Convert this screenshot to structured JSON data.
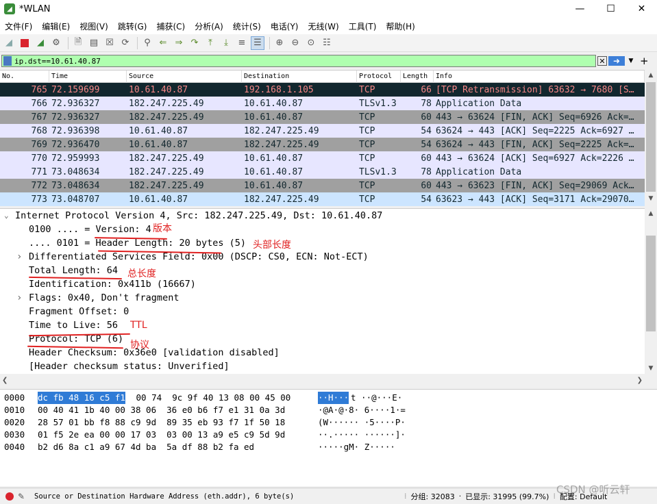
{
  "window": {
    "title": "*WLAN"
  },
  "menu": [
    "文件(F)",
    "编辑(E)",
    "视图(V)",
    "跳转(G)",
    "捕获(C)",
    "分析(A)",
    "统计(S)",
    "电话(Y)",
    "无线(W)",
    "工具(T)",
    "帮助(H)"
  ],
  "filter": {
    "value": "ip.dst==10.61.40.87"
  },
  "columns": [
    "No.",
    "Time",
    "Source",
    "Destination",
    "Protocol",
    "Length",
    "Info"
  ],
  "packets": [
    {
      "no": "765",
      "time": "72.159699",
      "src": "10.61.40.87",
      "dst": "192.168.1.105",
      "proto": "TCP",
      "len": "66",
      "info": "[TCP Retransmission] 63632 → 7680 [S…",
      "bg": "#12272e",
      "fg": "#f78787"
    },
    {
      "no": "766",
      "time": "72.936327",
      "src": "182.247.225.49",
      "dst": "10.61.40.87",
      "proto": "TLSv1.3",
      "len": "78",
      "info": "Application Data",
      "bg": "#e7e6ff",
      "fg": "#12272e"
    },
    {
      "no": "767",
      "time": "72.936327",
      "src": "182.247.225.49",
      "dst": "10.61.40.87",
      "proto": "TCP",
      "len": "60",
      "info": "443 → 63624 [FIN, ACK] Seq=6926 Ack=…",
      "bg": "#a0a0a0",
      "fg": "#12272e"
    },
    {
      "no": "768",
      "time": "72.936398",
      "src": "10.61.40.87",
      "dst": "182.247.225.49",
      "proto": "TCP",
      "len": "54",
      "info": "63624 → 443 [ACK] Seq=2225 Ack=6927 …",
      "bg": "#e7e6ff",
      "fg": "#12272e"
    },
    {
      "no": "769",
      "time": "72.936470",
      "src": "10.61.40.87",
      "dst": "182.247.225.49",
      "proto": "TCP",
      "len": "54",
      "info": "63624 → 443 [FIN, ACK] Seq=2225 Ack=…",
      "bg": "#a0a0a0",
      "fg": "#12272e"
    },
    {
      "no": "770",
      "time": "72.959993",
      "src": "182.247.225.49",
      "dst": "10.61.40.87",
      "proto": "TCP",
      "len": "60",
      "info": "443 → 63624 [ACK] Seq=6927 Ack=2226 …",
      "bg": "#e7e6ff",
      "fg": "#12272e"
    },
    {
      "no": "771",
      "time": "73.048634",
      "src": "182.247.225.49",
      "dst": "10.61.40.87",
      "proto": "TLSv1.3",
      "len": "78",
      "info": "Application Data",
      "bg": "#e7e6ff",
      "fg": "#12272e"
    },
    {
      "no": "772",
      "time": "73.048634",
      "src": "182.247.225.49",
      "dst": "10.61.40.87",
      "proto": "TCP",
      "len": "60",
      "info": "443 → 63623 [FIN, ACK] Seq=29069 Ack…",
      "bg": "#a0a0a0",
      "fg": "#12272e"
    },
    {
      "no": "773",
      "time": "73.048707",
      "src": "10.61.40.87",
      "dst": "182.247.225.49",
      "proto": "TCP",
      "len": "54",
      "info": "63623 → 443 [ACK] Seq=3171 Ack=29070…",
      "bg": "#cce5ff",
      "fg": "#12272e"
    }
  ],
  "detail": {
    "header": "Internet Protocol Version 4, Src: 182.247.225.49, Dst: 10.61.40.87",
    "lines": [
      {
        "text": "0100 .... = Version: 4",
        "expand": false
      },
      {
        "text": ".... 0101 = Header Length: 20 bytes (5)",
        "expand": false
      },
      {
        "text": "Differentiated Services Field: 0x00 (DSCP: CS0, ECN: Not-ECT)",
        "expand": true
      },
      {
        "text": "Total Length: 64",
        "expand": false
      },
      {
        "text": "Identification: 0x411b (16667)",
        "expand": false
      },
      {
        "text": "Flags: 0x40, Don't fragment",
        "expand": true
      },
      {
        "text": "Fragment Offset: 0",
        "expand": false
      },
      {
        "text": "Time to Live: 56",
        "expand": false
      },
      {
        "text": "Protocol: TCP (6)",
        "expand": false
      },
      {
        "text": "Header Checksum: 0x36e0 [validation disabled]",
        "expand": false
      },
      {
        "text": "[Header checksum status: Unverified]",
        "expand": false
      }
    ],
    "annotations": [
      "版本",
      "头部长度",
      "总长度",
      "TTL",
      "协议"
    ]
  },
  "bytes": [
    {
      "off": "0000",
      "hex_hl": "dc fb 48 16 c5 f1",
      "hex": " 00 74  9c 9f 40 13 08 00 45 00",
      "ascii_hl": "··H···",
      "ascii": "t ··@···E·"
    },
    {
      "off": "0010",
      "hex_hl": "",
      "hex": "00 40 41 1b 40 00 38 06  36 e0 b6 f7 e1 31 0a 3d",
      "ascii_hl": "",
      "ascii": "·@A·@·8· 6····1·="
    },
    {
      "off": "0020",
      "hex_hl": "",
      "hex": "28 57 01 bb f8 88 c9 9d  89 35 eb 93 f7 1f 50 18",
      "ascii_hl": "",
      "ascii": "(W······ ·5····P·"
    },
    {
      "off": "0030",
      "hex_hl": "",
      "hex": "01 f5 2e ea 00 00 17 03  03 00 13 a9 e5 c9 5d 9d",
      "ascii_hl": "",
      "ascii": "··.····· ······]·"
    },
    {
      "off": "0040",
      "hex_hl": "",
      "hex": "b2 d6 8a c1 a9 67 4d ba  5a df 88 b2 fa ed",
      "ascii_hl": "",
      "ascii": "·····gM· Z·····"
    }
  ],
  "status": {
    "field": "Source or Destination Hardware Address (eth.addr), 6 byte(s)",
    "packets": "分组: 32083",
    "displayed": "已显示: 31995 (99.7%)",
    "profile": "配置: Default",
    "watermark": "CSDN @听云轩"
  }
}
